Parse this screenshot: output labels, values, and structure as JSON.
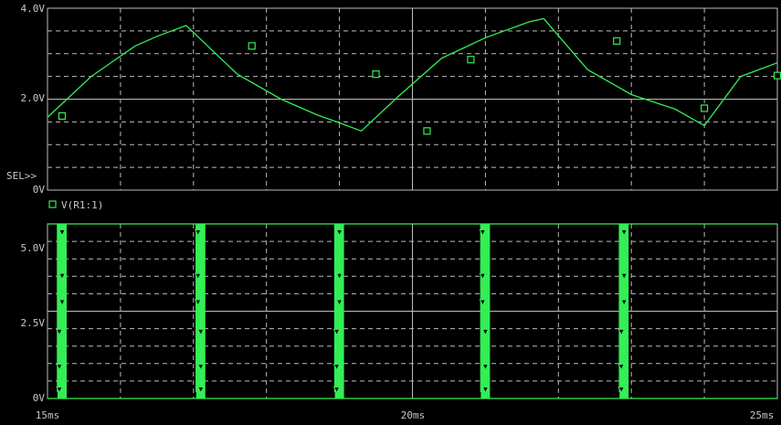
{
  "colors": {
    "background": "#000000",
    "grid": "#bdbdbd",
    "trace": "#33ee55",
    "text": "#c8c8c8"
  },
  "chart_data": [
    {
      "type": "line",
      "title": "",
      "xlabel": "",
      "ylabel": "",
      "grid": true,
      "xlim": [
        15,
        25
      ],
      "ylim": [
        0,
        4
      ],
      "yticks": [
        "4.0V",
        "2.0V",
        "0V"
      ],
      "xticks": [
        "15ms",
        "20ms",
        "25ms"
      ],
      "selector_label": "SEL>>",
      "legend_marker": "square",
      "series": [
        {
          "name": "V(R1:1)",
          "x": [
            15.0,
            15.6,
            16.2,
            16.5,
            16.9,
            17.6,
            18.2,
            18.7,
            19.0,
            19.3,
            19.8,
            20.4,
            21.0,
            21.6,
            21.8,
            22.4,
            23.0,
            23.6,
            24.0,
            24.5,
            25.0
          ],
          "y": [
            1.6,
            2.5,
            3.17,
            3.38,
            3.62,
            2.55,
            2.0,
            1.65,
            1.48,
            1.3,
            2.05,
            2.9,
            3.35,
            3.7,
            3.77,
            2.65,
            2.1,
            1.78,
            1.42,
            2.5,
            2.8
          ],
          "marker_x": [
            15.2,
            17.8,
            19.5,
            20.2,
            20.8,
            22.8,
            24.0,
            25.0
          ],
          "marker_y": [
            1.63,
            3.17,
            2.55,
            1.3,
            2.87,
            3.28,
            1.8,
            2.52
          ]
        }
      ]
    },
    {
      "type": "line",
      "title": "",
      "xlabel": "",
      "ylabel": "",
      "grid": true,
      "xlim": [
        15,
        25
      ],
      "ylim": [
        0,
        5
      ],
      "yticks": [
        "5.0V",
        "2.5V",
        "0V"
      ],
      "xticks": [
        "15ms",
        "20ms",
        "25ms"
      ],
      "pulse_x": [
        15.2,
        17.1,
        19.0,
        21.0,
        22.9
      ],
      "pulse_high": 5.0,
      "pulse_low": 0.0,
      "triangle_marker_x": [
        15.2,
        17.1,
        19.0,
        21.0,
        22.9
      ]
    }
  ]
}
